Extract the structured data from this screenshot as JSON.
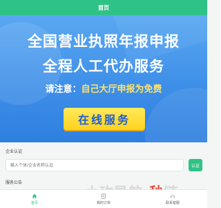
{
  "header": {
    "title": "首页"
  },
  "banner": {
    "line1": "全国营业执照年报申报",
    "line2": "全程人工代办服务",
    "notice_prefix": "请注意：",
    "notice_highlight": "自己大厅申报为免费",
    "cta_label": "在线服务"
  },
  "company_auth": {
    "title": "企业认证",
    "search_placeholder": "输入个体/企业名称认证",
    "search_button": "认证"
  },
  "section2": {
    "title": "服务公告"
  },
  "watermark": {
    "part1": "小玫导航",
    "part2": "-秒",
    "part3": "链"
  },
  "tabbar": {
    "items": [
      {
        "label": "首页",
        "icon": "home-icon",
        "active": true
      },
      {
        "label": "我的订单",
        "icon": "order-icon",
        "active": false
      },
      {
        "label": "联系客服",
        "icon": "customer-service-icon",
        "active": false
      }
    ]
  },
  "colors": {
    "accent": "#2fc287",
    "banner": "#3e8fe8",
    "cta": "#ffd21f"
  }
}
